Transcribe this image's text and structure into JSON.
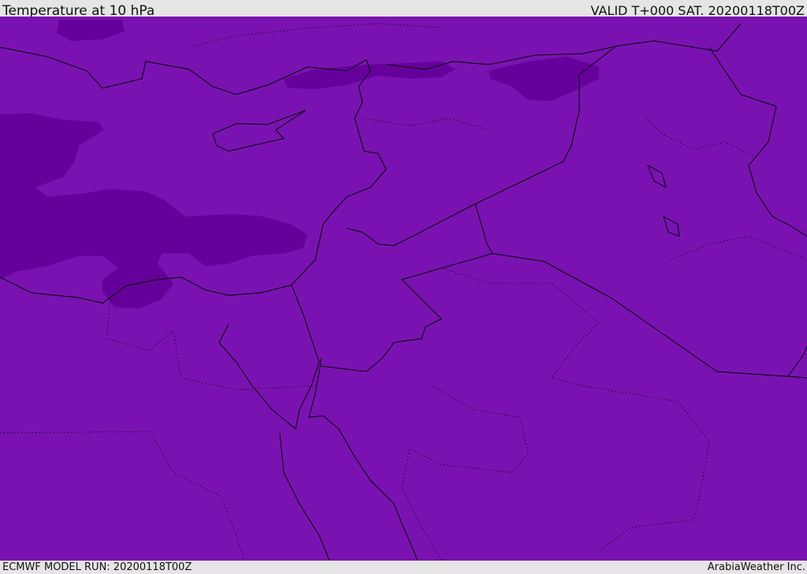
{
  "header": {
    "title": "Temperature at 10 hPa",
    "valid": "VALID T+000 SAT. 20200118T00Z"
  },
  "footer": {
    "model_run": "ECMWF MODEL RUN: 20200118T00Z",
    "credit": "ArabiaWeather Inc."
  },
  "colors": {
    "field_main": "#7a12b2",
    "field_cold": "#66009b",
    "coastline": "#000000"
  }
}
